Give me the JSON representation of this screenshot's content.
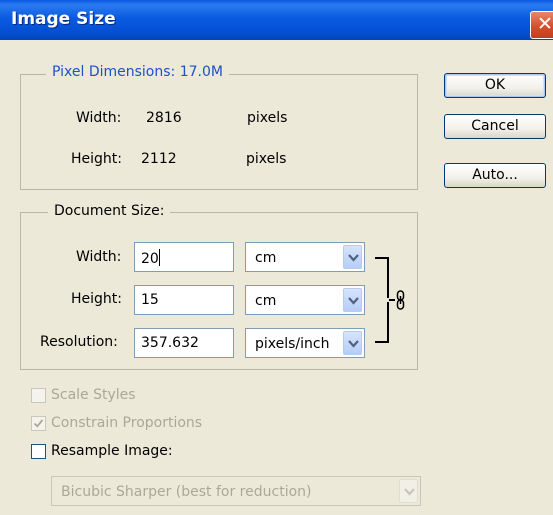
{
  "window": {
    "title": "Image Size",
    "close_glyph": "✕"
  },
  "pixel_dimensions": {
    "legend": "Pixel Dimensions:  17.0M",
    "width_label": "Width:",
    "width_value": "2816",
    "width_unit": "pixels",
    "height_label": "Height:",
    "height_value": "2112",
    "height_unit": "pixels"
  },
  "document_size": {
    "legend": "Document Size:",
    "width_label": "Width:",
    "width_value": "20",
    "width_unit": "cm",
    "height_label": "Height:",
    "height_value": "15",
    "height_unit": "cm",
    "resolution_label": "Resolution:",
    "resolution_value": "357.632",
    "resolution_unit": "pixels/inch",
    "link_icon": "chain-link-icon"
  },
  "options": {
    "scale_styles": {
      "label": "Scale Styles",
      "checked": false,
      "enabled": false
    },
    "constrain_proportions": {
      "label": "Constrain Proportions",
      "checked": true,
      "enabled": false
    },
    "resample_image": {
      "label": "Resample Image:",
      "checked": false,
      "enabled": true
    },
    "resample_method": "Bicubic Sharper (best for reduction)"
  },
  "buttons": {
    "ok": "OK",
    "cancel": "Cancel",
    "auto": "Auto..."
  },
  "colors": {
    "titlebar": "#0a5ae0",
    "dialog_bg": "#ece9d8",
    "legend_blue": "#1b52c4",
    "disabled_text": "#aca899"
  }
}
